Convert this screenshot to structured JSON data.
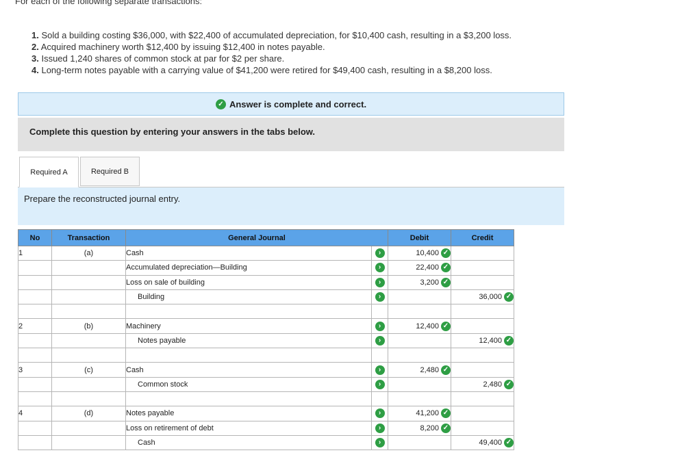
{
  "intro": {
    "text": "For each of the following separate transactions:"
  },
  "transactions": [
    {
      "n": "1.",
      "text": "Sold a building costing $36,000, with $22,400 of accumulated depreciation, for $10,400 cash, resulting in a $3,200 loss."
    },
    {
      "n": "2.",
      "text": "Acquired machinery worth $12,400 by issuing $12,400 in notes payable."
    },
    {
      "n": "3.",
      "text": "Issued 1,240 shares of common stock at par for $2 per share."
    },
    {
      "n": "4.",
      "text": "Long-term notes payable with a carrying value of $41,200 were retired for $49,400 cash, resulting in a $8,200 loss."
    }
  ],
  "banner": {
    "text": "Answer is complete and correct.",
    "icon": "check-circle-icon",
    "color": "#2e9e44"
  },
  "complete": {
    "text": "Complete this question by entering your answers in the tabs below."
  },
  "tabs": [
    {
      "label": "Required A"
    },
    {
      "label": "Required B"
    }
  ],
  "instruction": {
    "text": "Prepare the reconstructed journal entry."
  },
  "table": {
    "headers": {
      "no": "No",
      "transaction": "Transaction",
      "journal": "General Journal",
      "debit": "Debit",
      "credit": "Credit"
    },
    "rows": [
      {
        "no": "1",
        "tr": "(a)",
        "acct": "Cash",
        "indent": false,
        "mark": true,
        "debit": "10,400",
        "credit": ""
      },
      {
        "no": "",
        "tr": "",
        "acct": "Accumulated depreciation—Building",
        "indent": false,
        "mark": true,
        "debit": "22,400",
        "credit": ""
      },
      {
        "no": "",
        "tr": "",
        "acct": "Loss on sale of building",
        "indent": false,
        "mark": true,
        "debit": "3,200",
        "credit": ""
      },
      {
        "no": "",
        "tr": "",
        "acct": "Building",
        "indent": true,
        "mark": true,
        "debit": "",
        "credit": "36,000"
      },
      {
        "no": "",
        "tr": "",
        "acct": "",
        "indent": false,
        "mark": false,
        "debit": "",
        "credit": ""
      },
      {
        "no": "2",
        "tr": "(b)",
        "acct": "Machinery",
        "indent": false,
        "mark": true,
        "debit": "12,400",
        "credit": ""
      },
      {
        "no": "",
        "tr": "",
        "acct": "Notes payable",
        "indent": true,
        "mark": true,
        "debit": "",
        "credit": "12,400"
      },
      {
        "no": "",
        "tr": "",
        "acct": "",
        "indent": false,
        "mark": false,
        "debit": "",
        "credit": ""
      },
      {
        "no": "3",
        "tr": "(c)",
        "acct": "Cash",
        "indent": false,
        "mark": true,
        "debit": "2,480",
        "credit": ""
      },
      {
        "no": "",
        "tr": "",
        "acct": "Common stock",
        "indent": true,
        "mark": true,
        "debit": "",
        "credit": "2,480"
      },
      {
        "no": "",
        "tr": "",
        "acct": "",
        "indent": false,
        "mark": false,
        "debit": "",
        "credit": ""
      },
      {
        "no": "4",
        "tr": "(d)",
        "acct": "Notes payable",
        "indent": false,
        "mark": true,
        "debit": "41,200",
        "credit": ""
      },
      {
        "no": "",
        "tr": "",
        "acct": "Loss on retirement of debt",
        "indent": false,
        "mark": true,
        "debit": "8,200",
        "credit": ""
      },
      {
        "no": "",
        "tr": "",
        "acct": "Cash",
        "indent": true,
        "mark": true,
        "debit": "",
        "credit": "49,400"
      }
    ]
  }
}
